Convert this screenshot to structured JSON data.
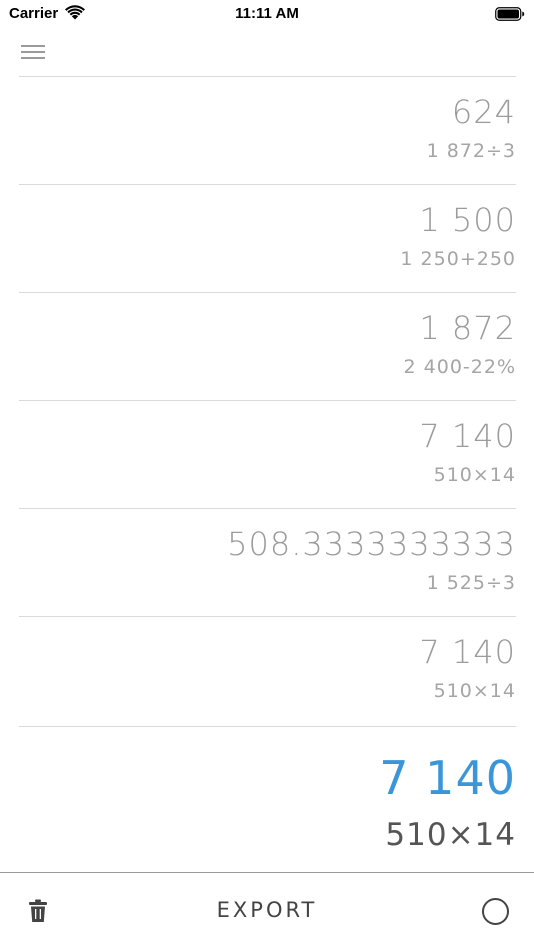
{
  "status_bar": {
    "carrier": "Carrier",
    "time": "11:11 AM",
    "wifi_icon": "wifi-icon",
    "battery_icon": "battery-icon"
  },
  "header": {
    "menu_icon": "hamburger-menu-icon"
  },
  "history": [
    {
      "result": "624",
      "expression": "1 872÷3"
    },
    {
      "result": "1 500",
      "expression": "1 250+250"
    },
    {
      "result": "1 872",
      "expression": "2 400-22%"
    },
    {
      "result": "7 140",
      "expression": "510×14"
    },
    {
      "result": "508.3333333333",
      "expression": "1 525÷3"
    },
    {
      "result": "7 140",
      "expression": "510×14"
    }
  ],
  "current": {
    "result": "7 140",
    "expression": "510×14"
  },
  "bottom_bar": {
    "export_label": "EXPORT",
    "trash_icon": "trash-icon",
    "circle_icon": "circle-icon"
  },
  "colors": {
    "accent": "#3a95d9",
    "history_text": "#9b9b9b",
    "divider": "#dadada"
  }
}
